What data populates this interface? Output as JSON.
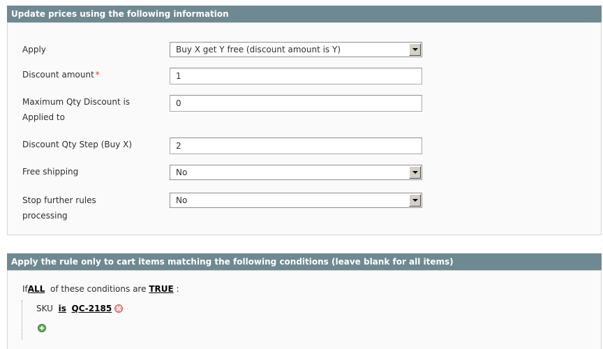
{
  "section1": {
    "title": "Update prices using the following information",
    "fields": [
      {
        "label": "Apply",
        "value": "Buy X get Y free (discount amount is Y)"
      },
      {
        "label": "Discount amount",
        "required_mark": "*",
        "value": "1"
      },
      {
        "label_line1": "Maximum Qty Discount is",
        "label_line2": "Applied to",
        "value": "0"
      },
      {
        "label": "Discount Qty Step (Buy X)",
        "value": "2"
      },
      {
        "label": "Free shipping",
        "value": "No"
      },
      {
        "label_line1": "Stop further rules",
        "label_line2": "processing",
        "value": "No"
      }
    ]
  },
  "section2": {
    "title": "Apply the rule only to cart items matching the following conditions (leave blank for all items)",
    "conditions": {
      "if_text": "If",
      "aggregator": "ALL",
      "middle_text": "of these conditions are",
      "value": "TRUE",
      "colon": ":",
      "rule": {
        "attribute": "SKU",
        "operator": "is",
        "value": "QC-2185"
      }
    }
  },
  "icons": {
    "select_arrow": "chevron-down-icon",
    "remove": "remove-icon",
    "add": "add-icon"
  },
  "colors": {
    "header_bg": "#6f8992",
    "required": "#eb340a",
    "add_icon": "#5fa94f",
    "remove_icon": "#f3a3a3"
  }
}
